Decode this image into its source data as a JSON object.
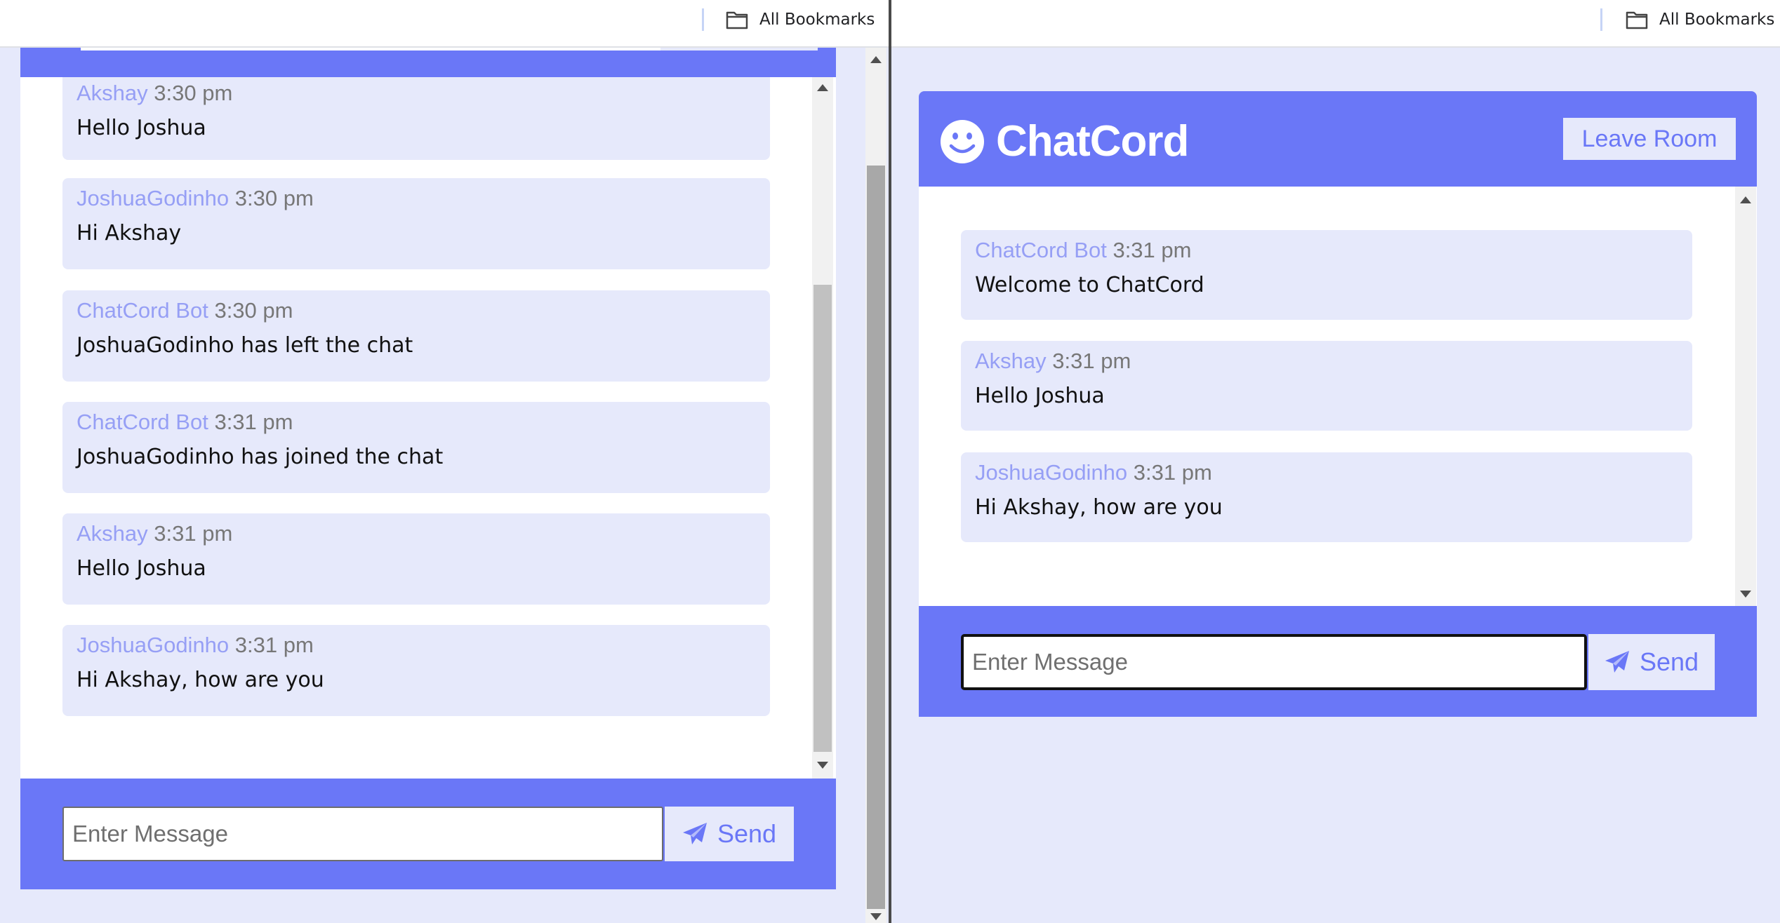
{
  "bookmarks": {
    "label": "All Bookmarks"
  },
  "app": {
    "title": "ChatCord",
    "leave_label": "Leave Room"
  },
  "left_window": {
    "messages": [
      {
        "user": "Akshay",
        "time": "3:30 pm",
        "text": "Hello Joshua"
      },
      {
        "user": "JoshuaGodinho",
        "time": "3:30 pm",
        "text": "Hi Akshay"
      },
      {
        "user": "ChatCord Bot",
        "time": "3:30 pm",
        "text": "JoshuaGodinho has left the chat"
      },
      {
        "user": "ChatCord Bot",
        "time": "3:31 pm",
        "text": "JoshuaGodinho has joined the chat"
      },
      {
        "user": "Akshay",
        "time": "3:31 pm",
        "text": "Hello Joshua"
      },
      {
        "user": "JoshuaGodinho",
        "time": "3:31 pm",
        "text": "Hi Akshay, how are you"
      }
    ],
    "input_placeholder": "Enter Message",
    "send_label": "Send"
  },
  "right_window": {
    "messages": [
      {
        "user": "ChatCord Bot",
        "time": "3:31 pm",
        "text": "Welcome to ChatCord"
      },
      {
        "user": "Akshay",
        "time": "3:31 pm",
        "text": "Hello Joshua"
      },
      {
        "user": "JoshuaGodinho",
        "time": "3:31 pm",
        "text": "Hi Akshay, how are you"
      }
    ],
    "input_placeholder": "Enter Message",
    "send_label": "Send"
  },
  "colors": {
    "primary": "#6a77f7",
    "light": "#e6e9fb",
    "username": "#969ff5",
    "time": "#777777"
  },
  "icons": {
    "folder": "folder-icon",
    "send": "paper-plane-icon",
    "logo": "smile-icon"
  }
}
